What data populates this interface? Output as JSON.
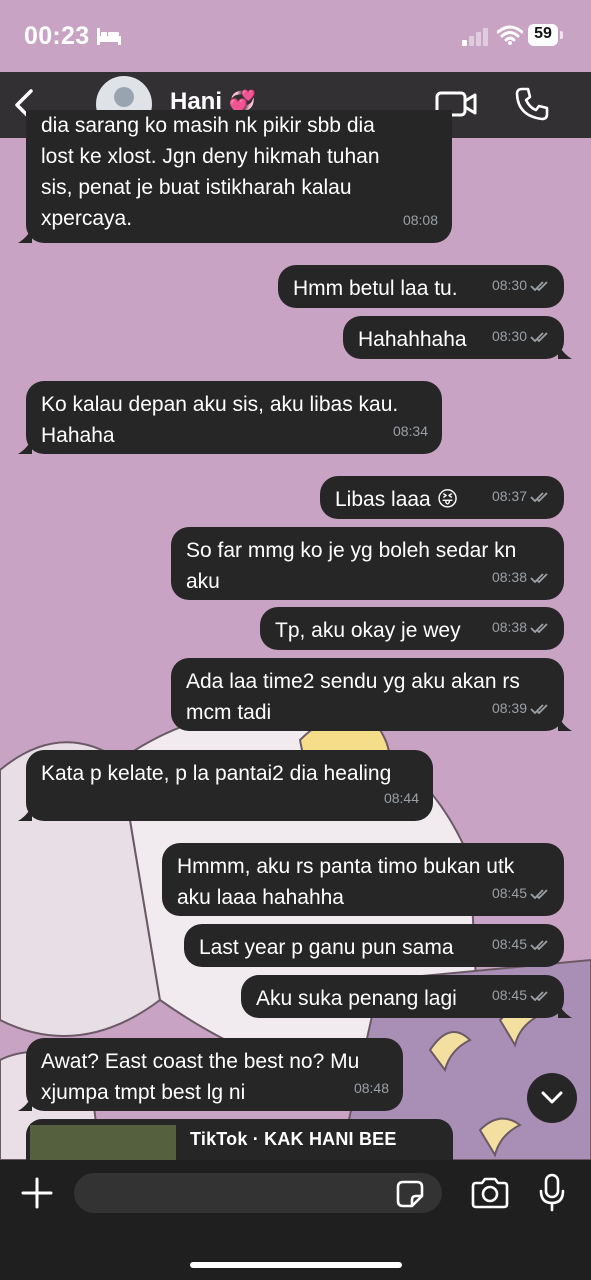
{
  "status": {
    "time": "00:23",
    "battery": "59"
  },
  "header": {
    "contact_name": "Hani",
    "contact_emoji": "💞"
  },
  "messages": [
    {
      "dir": "in",
      "text": "dia sarang ko masih nk pikir sbb dia\nlost ke xlost. Jgn deny hikmah tuhan\nsis, penat je buat istikharah kalau\nxpercaya.",
      "time": "08:08"
    },
    {
      "dir": "out",
      "text": "Hmm betul laa tu.",
      "time": "08:30"
    },
    {
      "dir": "out",
      "text": "Hahahhaha",
      "time": "08:30"
    },
    {
      "dir": "in",
      "text": "Ko kalau depan aku sis, aku libas kau.\nHahaha",
      "time": "08:34"
    },
    {
      "dir": "out",
      "text": "Libas laaa 😝",
      "time": "08:37"
    },
    {
      "dir": "out",
      "text": "So far mmg ko je yg boleh sedar kn\naku",
      "time": "08:38"
    },
    {
      "dir": "out",
      "text": "Tp, aku okay je wey",
      "time": "08:38"
    },
    {
      "dir": "out",
      "text": "Ada laa time2 sendu yg aku akan rs\nmcm tadi",
      "time": "08:39"
    },
    {
      "dir": "in",
      "text": "Kata p kelate, p la pantai2 dia healing",
      "time": "08:44"
    },
    {
      "dir": "out",
      "text": "Hmmm, aku rs panta timo bukan utk\naku laaa hahahha",
      "time": "08:45"
    },
    {
      "dir": "out",
      "text": "Last year p ganu pun sama",
      "time": "08:45"
    },
    {
      "dir": "out",
      "text": "Aku suka penang lagi",
      "time": "08:45"
    },
    {
      "dir": "in",
      "text": "Awat? East coast the best no? Mu\nxjumpa tmpt best lg ni",
      "time": "08:48"
    }
  ],
  "link_preview": {
    "title": "TikTok · KAK HANI BEE"
  },
  "composer": {
    "placeholder": ""
  },
  "colors": {
    "bubble": "#262626",
    "wallpaper": "#c9a3c4",
    "timestamp": "#9aa0a6",
    "header": "#262626"
  },
  "icons": {
    "status": [
      "bed-icon",
      "signal-icon",
      "wifi-icon",
      "battery-icon"
    ],
    "header": [
      "back-icon",
      "avatar-icon",
      "video-call-icon",
      "phone-call-icon"
    ],
    "composer": [
      "plus-icon",
      "sticker-icon",
      "camera-icon",
      "microphone-icon"
    ],
    "chat": [
      "read-receipt-icon",
      "chevron-down-icon"
    ]
  }
}
